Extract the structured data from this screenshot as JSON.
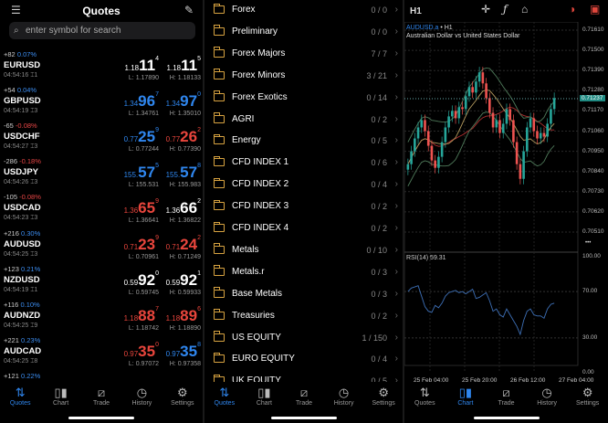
{
  "quotes": {
    "title": "Quotes",
    "search_placeholder": "enter symbol for search",
    "rows": [
      {
        "chg": "+82",
        "pct": "0.07%",
        "dir": "pos",
        "symbol": "EURUSD",
        "time": "04:54:16",
        "spread": "1",
        "bid": {
          "pre": "1.18",
          "big": "11",
          "sup": "4",
          "color": "white"
        },
        "ask": {
          "pre": "1.18",
          "big": "11",
          "sup": "5",
          "color": "white"
        },
        "low": "L: 1.17890",
        "high": "H: 1.18133"
      },
      {
        "chg": "+54",
        "pct": "0.04%",
        "dir": "pos",
        "symbol": "GBPUSD",
        "time": "04:54:19",
        "spread": "3",
        "bid": {
          "pre": "1.34",
          "big": "96",
          "sup": "7",
          "color": "blue"
        },
        "ask": {
          "pre": "1.34",
          "big": "97",
          "sup": "0",
          "color": "blue"
        },
        "low": "L: 1.34761",
        "high": "H: 1.35010"
      },
      {
        "chg": "-65",
        "pct": "-0.08%",
        "dir": "neg",
        "symbol": "USDCHF",
        "time": "04:54:27",
        "spread": "3",
        "bid": {
          "pre": "0.77",
          "big": "25",
          "sup": "9",
          "color": "blue"
        },
        "ask": {
          "pre": "0.77",
          "big": "26",
          "sup": "2",
          "color": "red"
        },
        "low": "L: 0.77244",
        "high": "H: 0.77390"
      },
      {
        "chg": "-286",
        "pct": "-0.18%",
        "dir": "neg",
        "symbol": "USDJPY",
        "time": "04:54:26",
        "spread": "3",
        "bid": {
          "pre": "155.",
          "big": "57",
          "sup": "5",
          "color": "blue"
        },
        "ask": {
          "pre": "155.",
          "big": "57",
          "sup": "8",
          "color": "blue"
        },
        "low": "L: 155.531",
        "high": "H: 155.983"
      },
      {
        "chg": "-105",
        "pct": "-0.08%",
        "dir": "neg",
        "symbol": "USDCAD",
        "time": "04:54:23",
        "spread": "3",
        "bid": {
          "pre": "1.36",
          "big": "65",
          "sup": "9",
          "color": "red"
        },
        "ask": {
          "pre": "1.36",
          "big": "66",
          "sup": "2",
          "color": "white"
        },
        "low": "L: 1.36641",
        "high": "H: 1.36822"
      },
      {
        "chg": "+216",
        "pct": "0.30%",
        "dir": "pos",
        "symbol": "AUDUSD",
        "time": "04:54:25",
        "spread": "3",
        "bid": {
          "pre": "0.71",
          "big": "23",
          "sup": "9",
          "color": "red"
        },
        "ask": {
          "pre": "0.71",
          "big": "24",
          "sup": "2",
          "color": "red"
        },
        "low": "L: 0.70961",
        "high": "H: 0.71249"
      },
      {
        "chg": "+123",
        "pct": "0.21%",
        "dir": "pos",
        "symbol": "NZDUSD",
        "time": "04:54:19",
        "spread": "1",
        "bid": {
          "pre": "0.59",
          "big": "92",
          "sup": "0",
          "color": "white"
        },
        "ask": {
          "pre": "0.59",
          "big": "92",
          "sup": "1",
          "color": "white"
        },
        "low": "L: 0.59745",
        "high": "H: 0.59933"
      },
      {
        "chg": "+116",
        "pct": "0.10%",
        "dir": "pos",
        "symbol": "AUDNZD",
        "time": "04:54:25",
        "spread": "9",
        "bid": {
          "pre": "1.18",
          "big": "88",
          "sup": "7",
          "color": "red"
        },
        "ask": {
          "pre": "1.18",
          "big": "89",
          "sup": "6",
          "color": "red"
        },
        "low": "L: 1.18742",
        "high": "H: 1.18890"
      },
      {
        "chg": "+221",
        "pct": "0.23%",
        "dir": "pos",
        "symbol": "AUDCAD",
        "time": "04:54:25",
        "spread": "8",
        "bid": {
          "pre": "0.97",
          "big": "35",
          "sup": "0",
          "color": "red"
        },
        "ask": {
          "pre": "0.97",
          "big": "35",
          "sup": "8",
          "color": "blue"
        },
        "low": "L: 0.97072",
        "high": "H: 0.97358"
      }
    ],
    "partial_row": {
      "chg": "+121",
      "pct": "0.22%"
    }
  },
  "symbols": {
    "folders": [
      {
        "name": "Forex",
        "count": "0 / 0"
      },
      {
        "name": "Preliminary",
        "count": "0 / 0"
      },
      {
        "name": "Forex Majors",
        "count": "7 / 7"
      },
      {
        "name": "Forex Minors",
        "count": "3 / 21"
      },
      {
        "name": "Forex Exotics",
        "count": "0 / 14"
      },
      {
        "name": "AGRI",
        "count": "0 / 2"
      },
      {
        "name": "Energy",
        "count": "0 / 5"
      },
      {
        "name": "CFD INDEX 1",
        "count": "0 / 6"
      },
      {
        "name": "CFD INDEX 2",
        "count": "0 / 4"
      },
      {
        "name": "CFD INDEX 3",
        "count": "0 / 2"
      },
      {
        "name": "CFD INDEX 4",
        "count": "0 / 2"
      },
      {
        "name": "Metals",
        "count": "0 / 10"
      },
      {
        "name": "Metals.r",
        "count": "0 / 3"
      },
      {
        "name": "Base Metals",
        "count": "0 / 3"
      },
      {
        "name": "Treasuries",
        "count": "0 / 2"
      },
      {
        "name": "US EQUITY",
        "count": "1 / 150"
      },
      {
        "name": "EURO EQUITY",
        "count": "0 / 4"
      },
      {
        "name": "UK EQUITY",
        "count": "0 / 5"
      }
    ]
  },
  "chart": {
    "timeframe": "H1",
    "symbol": "AUDUSD.a",
    "symbol_tf": "• H1",
    "description": "Australian Dollar vs United States Dollar",
    "current_price": "0.71237",
    "price_ticks": [
      "0.71610",
      "0.71500",
      "0.71390",
      "0.71280",
      "0.71170",
      "0.71060",
      "0.70950",
      "0.70840",
      "0.70730",
      "0.70620",
      "0.70510"
    ],
    "rsi_label": "RSI(14) 59.31",
    "rsi_ticks": [
      "100.00",
      "70.00",
      "30.00",
      "0.00"
    ],
    "time_ticks": [
      "25 Feb 04:00",
      "25 Feb 20:00",
      "26 Feb 12:00",
      "27 Feb 04:00"
    ],
    "more": "•••",
    "closes": [
      0.7088,
      0.7095,
      0.7102,
      0.7108,
      0.7112,
      0.7106,
      0.7098,
      0.709,
      0.7086,
      0.7092,
      0.71,
      0.7108,
      0.7114,
      0.7117,
      0.7113,
      0.7119,
      0.7118,
      0.7125,
      0.713,
      0.7127,
      0.7133,
      0.7138,
      0.7132,
      0.7124,
      0.7116,
      0.7108,
      0.7112,
      0.7105,
      0.711,
      0.7118,
      0.7112,
      0.71,
      0.7088,
      0.708,
      0.7095,
      0.7108,
      0.7113,
      0.7106,
      0.7102,
      0.7105,
      0.7103,
      0.711,
      0.7118,
      0.7124
    ],
    "rsi": [
      70,
      73,
      74,
      75,
      66,
      57,
      53,
      52,
      58,
      56,
      60,
      66,
      69,
      70,
      71,
      69,
      70,
      68,
      70,
      72,
      64,
      65,
      67,
      69,
      62,
      53,
      55,
      50,
      48,
      55,
      50,
      45,
      40,
      33,
      45,
      53,
      55,
      50,
      49,
      49,
      47,
      55,
      59,
      60
    ],
    "colors": {
      "up": "#26a69a",
      "down": "#ef5350",
      "rsi": "#3d6fb6",
      "ma": "#b03030",
      "band": "#4f7a5a",
      "band2": "#b49a5e"
    }
  },
  "nav": [
    {
      "label": "Quotes",
      "icon": "quotes-arrows-icon"
    },
    {
      "label": "Chart",
      "icon": "candles-icon"
    },
    {
      "label": "Trade",
      "icon": "trade-chart-icon"
    },
    {
      "label": "History",
      "icon": "history-clock-icon"
    },
    {
      "label": "Settings",
      "icon": "settings-gear-icon"
    }
  ],
  "accent": "#2f86ee"
}
